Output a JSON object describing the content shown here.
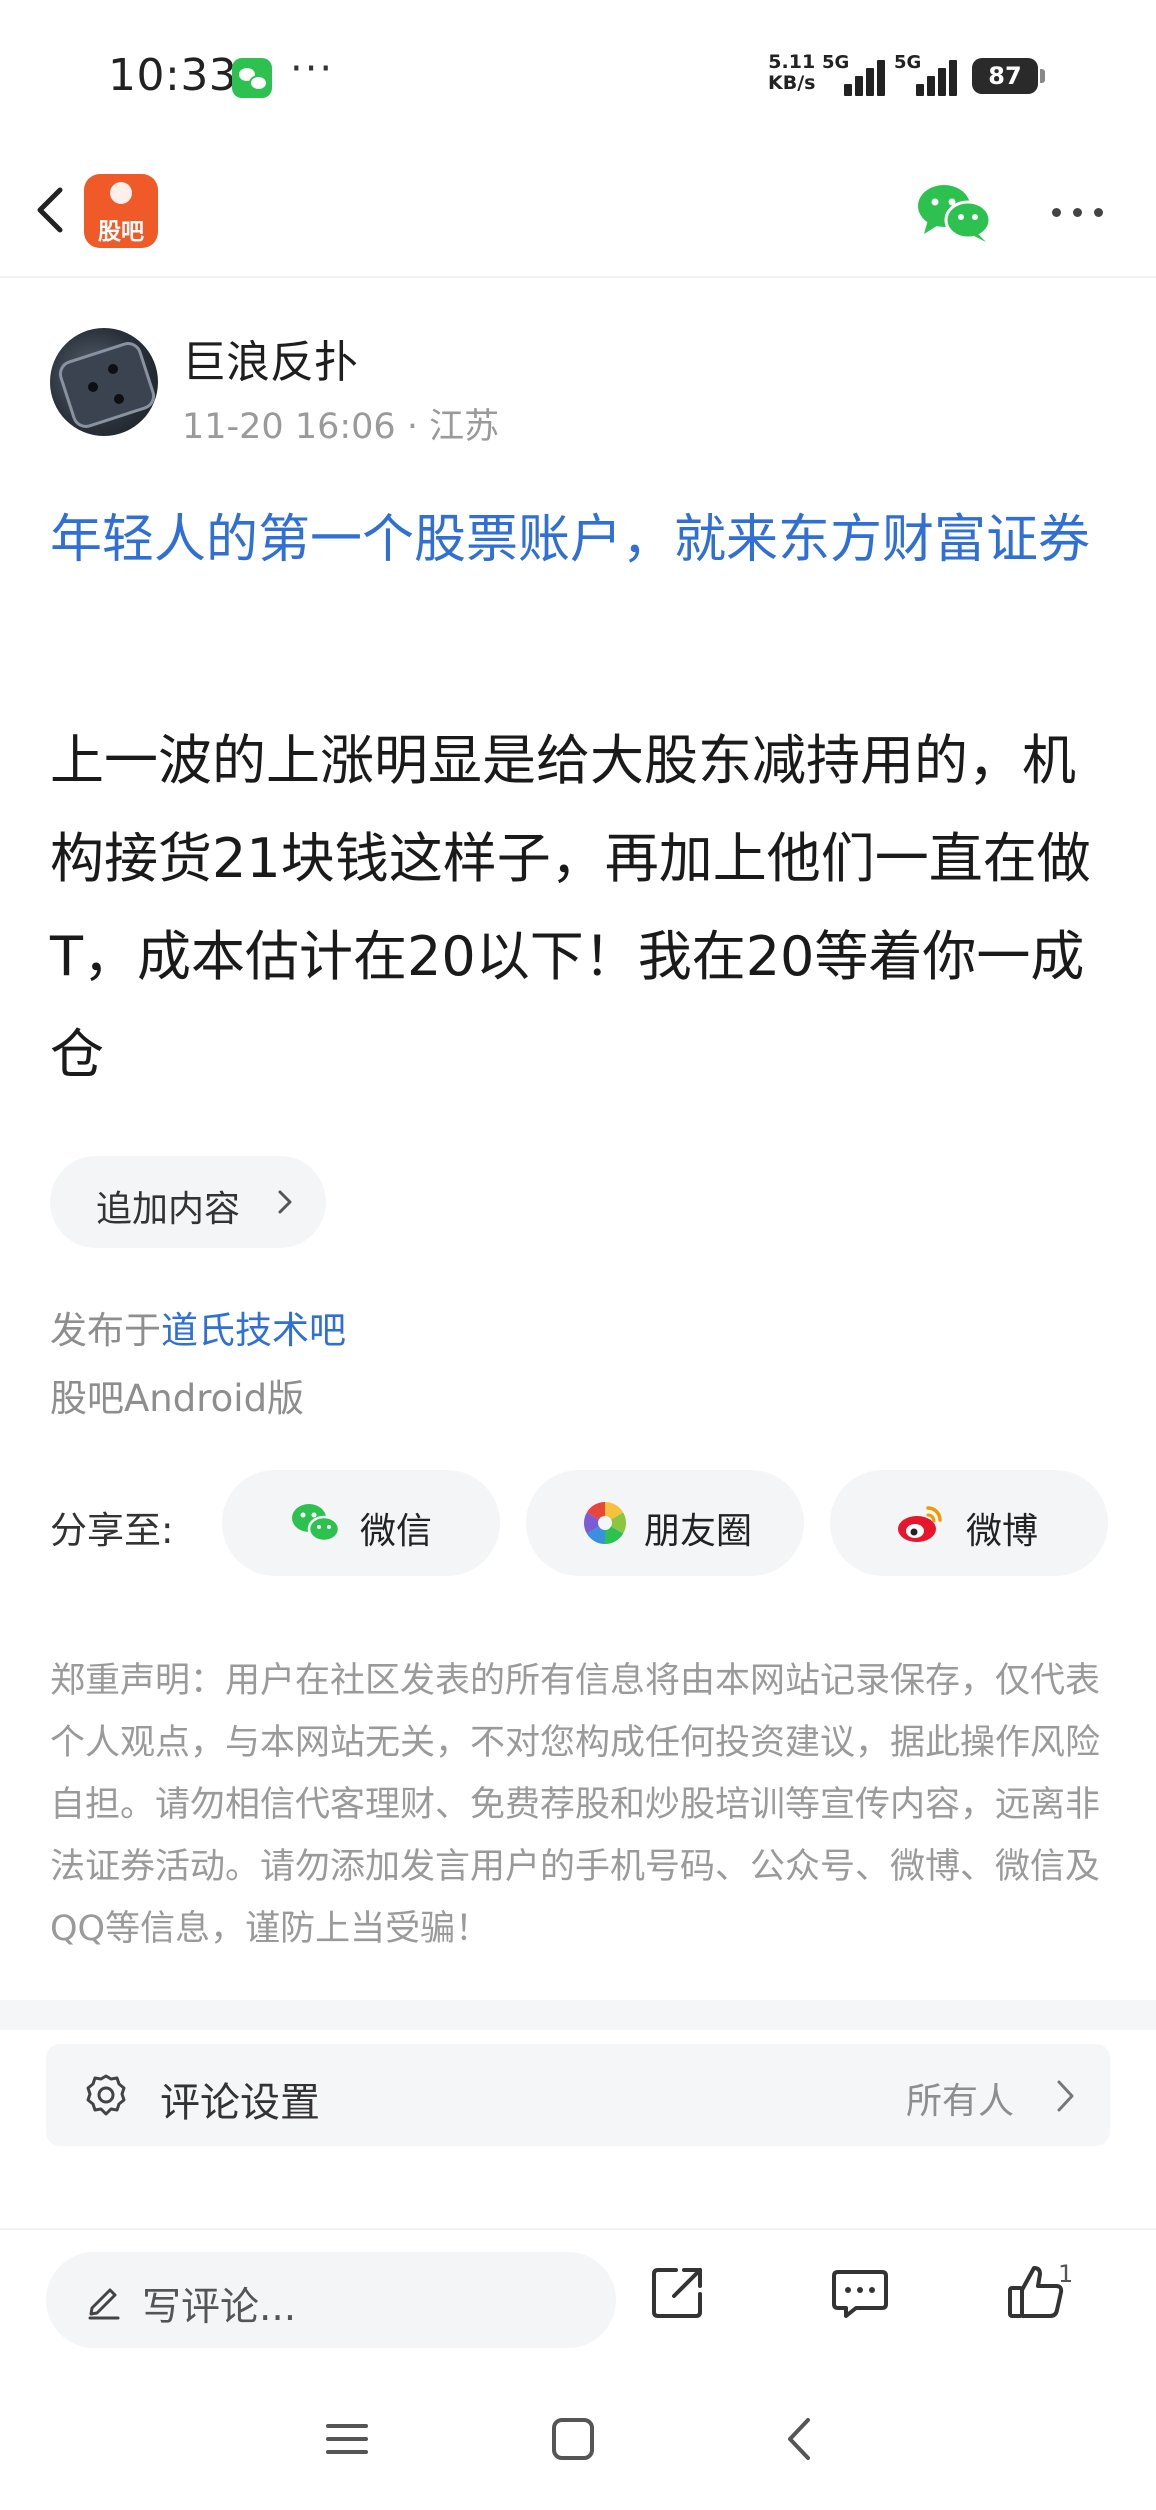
{
  "status_bar": {
    "time": "10:33",
    "net_rate_value": "5.11",
    "net_rate_unit": "KB/s",
    "sim1_label": "5G",
    "sim2_label": "5G",
    "battery": "87",
    "more": "···"
  },
  "header": {
    "logo_text": "股吧",
    "app_icon": "guba-logo-icon",
    "share_icon": "wechat-icon",
    "menu_icon": "more-dots-icon"
  },
  "post": {
    "author": "巨浪反扑",
    "date": "11-20 16:06",
    "location": "江苏",
    "title": "年轻人的第一个股票账户，就来东方财富证券",
    "body": "上一波的上涨明显是给大股东减持用的，机构接货21块钱这样子，再加上他们一直在做T，成本估计在20以下！我在20等着你一成仓",
    "append_label": "追加内容",
    "published_prefix": "发布于",
    "forum": "道氏技术吧",
    "platform": "股吧Android版"
  },
  "share": {
    "label": "分享至:",
    "targets": [
      {
        "label": "微信",
        "icon": "wechat-icon"
      },
      {
        "label": "朋友圈",
        "icon": "moments-icon"
      },
      {
        "label": "微博",
        "icon": "weibo-icon"
      }
    ]
  },
  "disclaimer": "郑重声明：用户在社区发表的所有信息将由本网站记录保存，仅代表个人观点，与本网站无关，不对您构成任何投资建议，据此操作风险自担。请勿相信代客理财、免费荐股和炒股培训等宣传内容，远离非法证券活动。请勿添加发言用户的手机号码、公众号、微博、微信及QQ等信息，谨防上当受骗！",
  "comment_settings": {
    "label": "评论设置",
    "value": "所有人"
  },
  "bottom_bar": {
    "comment_placeholder": "写评论...",
    "like_count": "1"
  },
  "colors": {
    "accent_blue": "#2f6fd6",
    "logo_orange": "#f05a28",
    "wechat_green": "#2dc24f"
  }
}
